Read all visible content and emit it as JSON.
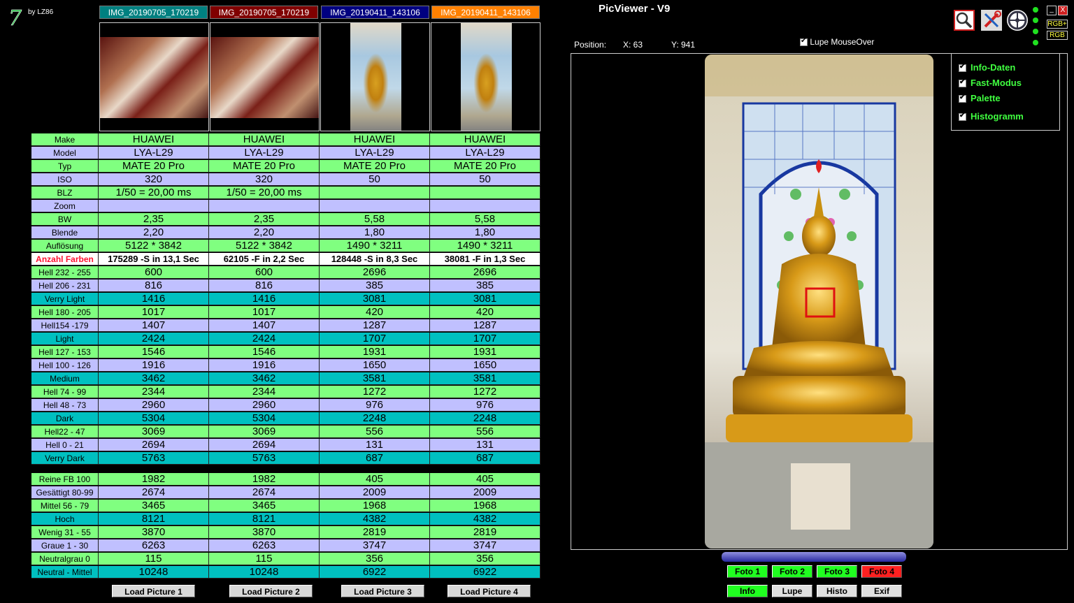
{
  "app": {
    "title": "PicViewer - V9",
    "by": "by LZ86",
    "logo_glyph": "7"
  },
  "files": [
    {
      "name": "IMG_20190705_170219",
      "color": "#008080"
    },
    {
      "name": "IMG_20190705_170219",
      "color": "#800000"
    },
    {
      "name": "IMG_20190411_143106",
      "color": "#000080"
    },
    {
      "name": "IMG_20190411_143106",
      "color": "#ff8000"
    }
  ],
  "rows": [
    {
      "label": "Make",
      "vals": [
        "HUAWEI",
        "HUAWEI",
        "HUAWEI",
        "HUAWEI"
      ],
      "c": "g"
    },
    {
      "label": "Model",
      "vals": [
        "LYA-L29",
        "LYA-L29",
        "LYA-L29",
        "LYA-L29"
      ],
      "c": "l"
    },
    {
      "label": "Typ",
      "vals": [
        "MATE 20 Pro",
        "MATE 20 Pro",
        "MATE 20 Pro",
        "MATE 20 Pro"
      ],
      "c": "g"
    },
    {
      "label": "ISO",
      "vals": [
        "320",
        "320",
        "50",
        "50"
      ],
      "c": "l"
    },
    {
      "label": "BLZ",
      "vals": [
        "1/50 = 20,00 ms",
        "1/50 = 20,00 ms",
        "",
        ""
      ],
      "c": "g"
    },
    {
      "label": "Zoom",
      "vals": [
        "",
        "",
        "",
        ""
      ],
      "c": "l"
    },
    {
      "label": "BW",
      "vals": [
        "2,35",
        "2,35",
        "5,58",
        "5,58"
      ],
      "c": "g"
    },
    {
      "label": "Blende",
      "vals": [
        "2,20",
        "2,20",
        "1,80",
        "1,80"
      ],
      "c": "l"
    },
    {
      "label": "Auflösung",
      "vals": [
        "5122 * 3842",
        "5122 * 3842",
        "1490 * 3211",
        "1490 * 3211"
      ],
      "c": "g"
    },
    {
      "label": "Anzahl Farben",
      "vals": [
        "175289 -S in 13,1 Sec",
        "62105 -F in 2,2 Sec",
        "128448 -S in 8,3 Sec",
        "38081 -F in 1,3 Sec"
      ],
      "c": "w",
      "bold": true
    },
    {
      "label": "Hell 232 - 255",
      "vals": [
        "600",
        "600",
        "2696",
        "2696"
      ],
      "c": "g"
    },
    {
      "label": "Hell 206 - 231",
      "vals": [
        "816",
        "816",
        "385",
        "385"
      ],
      "c": "l"
    },
    {
      "label": "Verry Light",
      "vals": [
        "1416",
        "1416",
        "3081",
        "3081"
      ],
      "c": "t"
    },
    {
      "label": "Hell 180 - 205",
      "vals": [
        "1017",
        "1017",
        "420",
        "420"
      ],
      "c": "g"
    },
    {
      "label": "Hell154 -179",
      "vals": [
        "1407",
        "1407",
        "1287",
        "1287"
      ],
      "c": "l"
    },
    {
      "label": "Light",
      "vals": [
        "2424",
        "2424",
        "1707",
        "1707"
      ],
      "c": "t"
    },
    {
      "label": "Hell 127 - 153",
      "vals": [
        "1546",
        "1546",
        "1931",
        "1931"
      ],
      "c": "g"
    },
    {
      "label": "Hell 100 - 126",
      "vals": [
        "1916",
        "1916",
        "1650",
        "1650"
      ],
      "c": "l"
    },
    {
      "label": "Medium",
      "vals": [
        "3462",
        "3462",
        "3581",
        "3581"
      ],
      "c": "t"
    },
    {
      "label": "Hell 74 - 99",
      "vals": [
        "2344",
        "2344",
        "1272",
        "1272"
      ],
      "c": "g"
    },
    {
      "label": "Hell 48 - 73",
      "vals": [
        "2960",
        "2960",
        "976",
        "976"
      ],
      "c": "l"
    },
    {
      "label": "Dark",
      "vals": [
        "5304",
        "5304",
        "2248",
        "2248"
      ],
      "c": "t"
    },
    {
      "label": "Hell22 - 47",
      "vals": [
        "3069",
        "3069",
        "556",
        "556"
      ],
      "c": "g"
    },
    {
      "label": "Hell 0 - 21",
      "vals": [
        "2694",
        "2694",
        "131",
        "131"
      ],
      "c": "l"
    },
    {
      "label": "Verry Dark",
      "vals": [
        "5763",
        "5763",
        "687",
        "687"
      ],
      "c": "t"
    },
    {
      "label": "Reine FB 100",
      "vals": [
        "1982",
        "1982",
        "405",
        "405"
      ],
      "c": "g"
    },
    {
      "label": "Gesättigt 80-99",
      "vals": [
        "2674",
        "2674",
        "2009",
        "2009"
      ],
      "c": "l"
    },
    {
      "label": "Mittel 56 - 79",
      "vals": [
        "3465",
        "3465",
        "1968",
        "1968"
      ],
      "c": "g"
    },
    {
      "label": "Hoch",
      "vals": [
        "8121",
        "8121",
        "4382",
        "4382"
      ],
      "c": "t"
    },
    {
      "label": "Wenig 31 - 55",
      "vals": [
        "3870",
        "3870",
        "2819",
        "2819"
      ],
      "c": "g"
    },
    {
      "label": "Graue 1 - 30",
      "vals": [
        "6263",
        "6263",
        "3747",
        "3747"
      ],
      "c": "l"
    },
    {
      "label": "Neutralgrau 0",
      "vals": [
        "115",
        "115",
        "356",
        "356"
      ],
      "c": "g"
    },
    {
      "label": "Neutral - Mittel",
      "vals": [
        "10248",
        "10248",
        "6922",
        "6922"
      ],
      "c": "t"
    }
  ],
  "load_buttons": [
    "Load Picture 1",
    "Load Picture 2",
    "Load Picture 3",
    "Load Picture 4"
  ],
  "position": {
    "label": "Position:",
    "x": "X: 63",
    "y": "Y: 941"
  },
  "lupe_mouseover": "Lupe MouseOver",
  "options": [
    "Info-Daten",
    "Fast-Modus",
    "Palette",
    "Histogramm"
  ],
  "rgb_labels": [
    "RGB+",
    "RGB"
  ],
  "window_buttons": [
    "_",
    "X"
  ],
  "foto_buttons": [
    "Foto 1",
    "Foto 2",
    "Foto 3",
    "Foto 4"
  ],
  "action_buttons": [
    "Info",
    "Lupe",
    "Histo",
    "Exif"
  ],
  "icons": [
    "magnifier-icon",
    "tools-icon",
    "network-icon"
  ]
}
